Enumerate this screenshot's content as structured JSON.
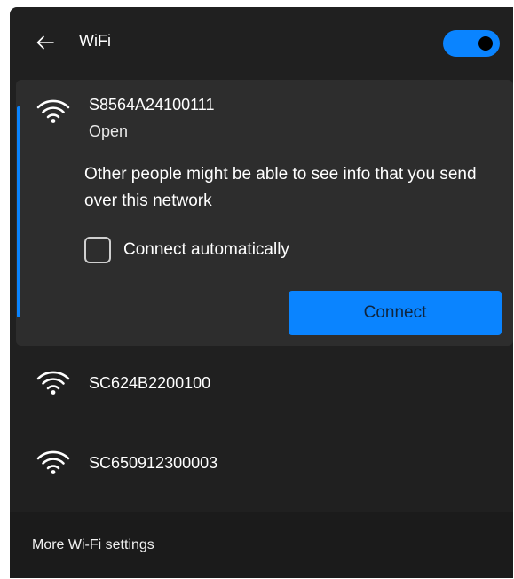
{
  "header": {
    "title": "WiFi",
    "back_icon": "arrow-left-icon",
    "wifi_enabled": true
  },
  "networks": [
    {
      "name": "S8564A24100111",
      "status": "Open",
      "warning": "Other people might be able to see info that you send over this network",
      "auto_connect_label": "Connect automatically",
      "auto_connect_checked": false,
      "connect_label": "Connect",
      "icon": "wifi-icon"
    },
    {
      "name": "SC624B2200100",
      "icon": "wifi-icon"
    },
    {
      "name": "SC650912300003",
      "icon": "wifi-icon"
    }
  ],
  "footer": {
    "settings_link": "More Wi-Fi settings"
  },
  "colors": {
    "accent": "#0a84ff",
    "panel_bg": "#202020",
    "expanded_bg": "#2d2d2d",
    "footer_bg": "#1b1b1b"
  }
}
